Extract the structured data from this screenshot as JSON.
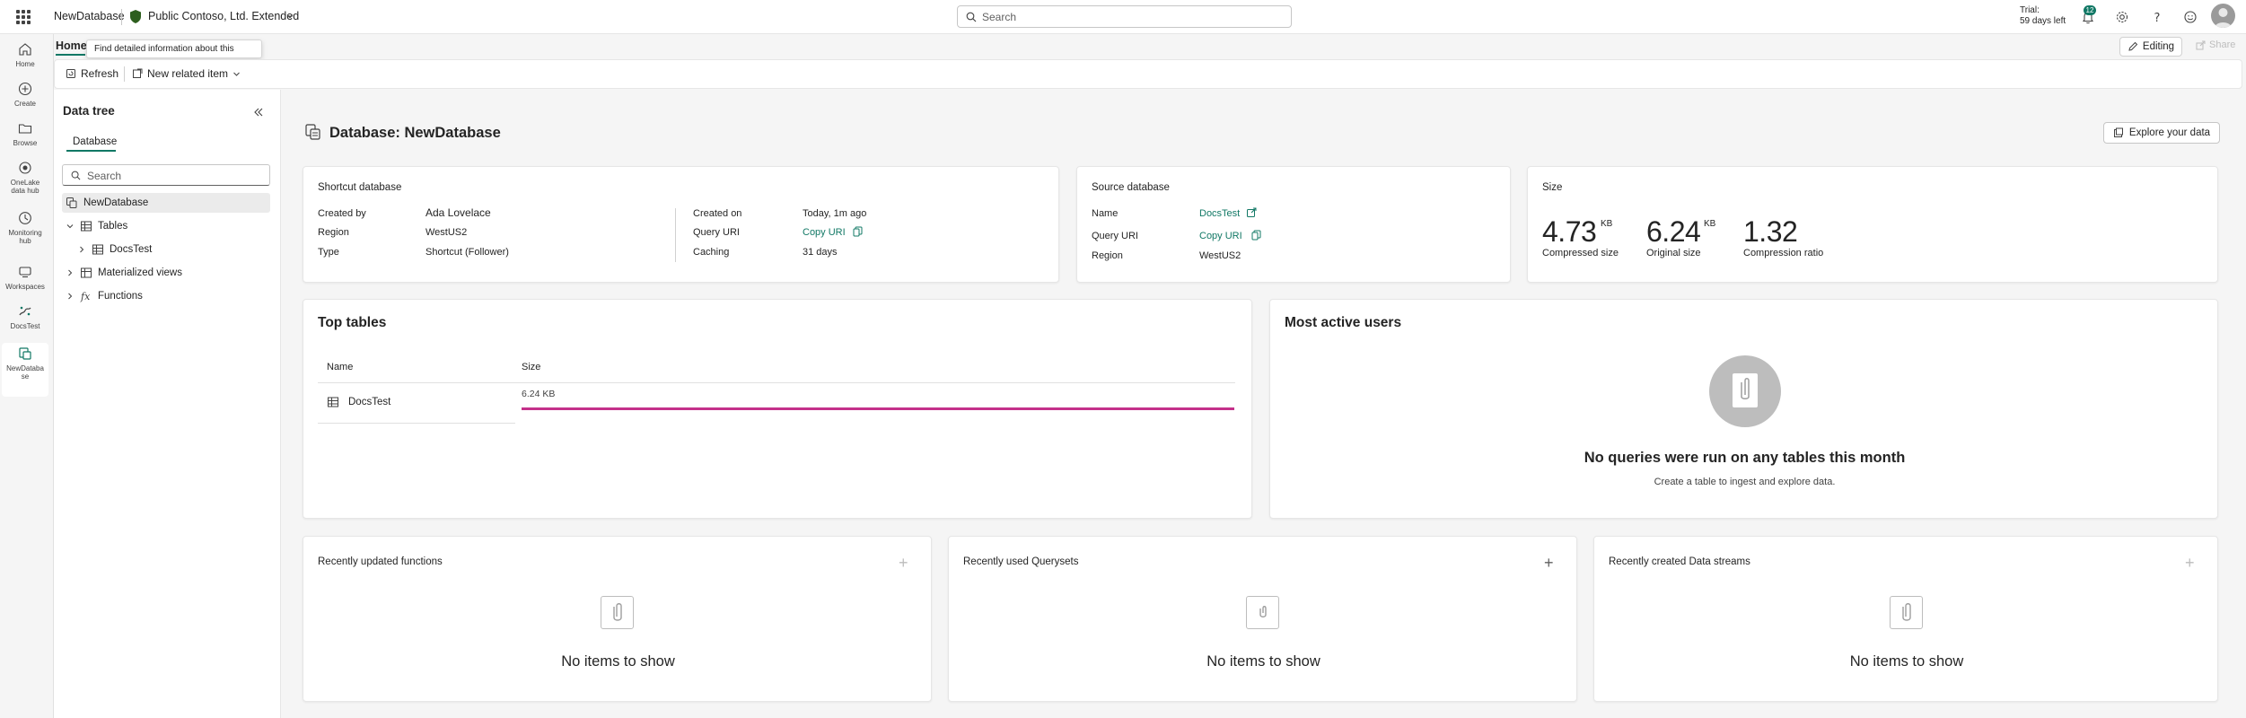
{
  "topbar": {
    "app_title": "NewDatabase",
    "workspace": "Public Contoso, Ltd. Extended",
    "search_placeholder": "Search",
    "trial_line1": "Trial:",
    "trial_line2": "59 days left",
    "notifications_count": "12",
    "accent": "#117865"
  },
  "rail": {
    "items": [
      {
        "label": "Home",
        "icon": "home-icon"
      },
      {
        "label": "Create",
        "icon": "plus-circle-icon"
      },
      {
        "label": "Browse",
        "icon": "folder-icon"
      },
      {
        "label1": "OneLake",
        "label2": "data hub",
        "icon": "onelake-icon"
      },
      {
        "label1": "Monitoring",
        "label2": "hub",
        "icon": "monitor-icon"
      },
      {
        "label": "Workspaces",
        "icon": "workspaces-icon"
      },
      {
        "label": "DocsTest",
        "icon": "docstest-icon"
      },
      {
        "label1": "NewDataba",
        "label2": "se",
        "icon": "database-icon"
      }
    ]
  },
  "ribbon": {
    "home_tab": "Home",
    "tooltip": "Find detailed information about this artifact",
    "refresh": "Refresh",
    "new_related_item": "New related item",
    "editing": "Editing",
    "share": "Share"
  },
  "tree": {
    "title": "Data tree",
    "tab": "Database",
    "search_placeholder": "Search",
    "root": "NewDatabase",
    "tables": "Tables",
    "table1": "DocsTest",
    "materialized_views": "Materialized views",
    "functions": "Functions"
  },
  "main": {
    "title": "Database: NewDatabase",
    "explore_button": "Explore your data"
  },
  "shortcut_card": {
    "heading": "Shortcut database",
    "created_by_label": "Created by",
    "created_by": "Ada Lovelace",
    "region_label": "Region",
    "region": "WestUS2",
    "type_label": "Type",
    "type": "Shortcut (Follower)",
    "created_on_label": "Created on",
    "created_on": "Today, 1m ago",
    "query_uri_label": "Query URI",
    "query_uri": "Copy URI",
    "caching_label": "Caching",
    "caching": "31 days"
  },
  "source_card": {
    "heading": "Source database",
    "name_label": "Name",
    "name": "DocsTest",
    "query_uri_label": "Query URI",
    "query_uri": "Copy URI",
    "region_label": "Region",
    "region": "WestUS2"
  },
  "size_card": {
    "heading": "Size",
    "compressed": "4.73",
    "compressed_unit": "KB",
    "compressed_label": "Compressed size",
    "original": "6.24",
    "original_unit": "KB",
    "original_label": "Original size",
    "ratio": "1.32",
    "ratio_label": "Compression ratio"
  },
  "top_tables": {
    "title": "Top tables",
    "col_name": "Name",
    "col_size": "Size",
    "rows": [
      {
        "name": "DocsTest",
        "size": "6.24 KB",
        "fraction": 1.0,
        "bar_color": "#c4318a"
      }
    ]
  },
  "active_users": {
    "title": "Most active users",
    "empty_title": "No queries were run on any tables this month",
    "empty_sub": "Create a table to ingest and explore data."
  },
  "bottom_cards": [
    {
      "title": "Recently updated functions",
      "empty": "No items to show"
    },
    {
      "title": "Recently used Querysets",
      "empty": "No items to show"
    },
    {
      "title": "Recently created Data streams",
      "empty": "No items to show"
    }
  ]
}
